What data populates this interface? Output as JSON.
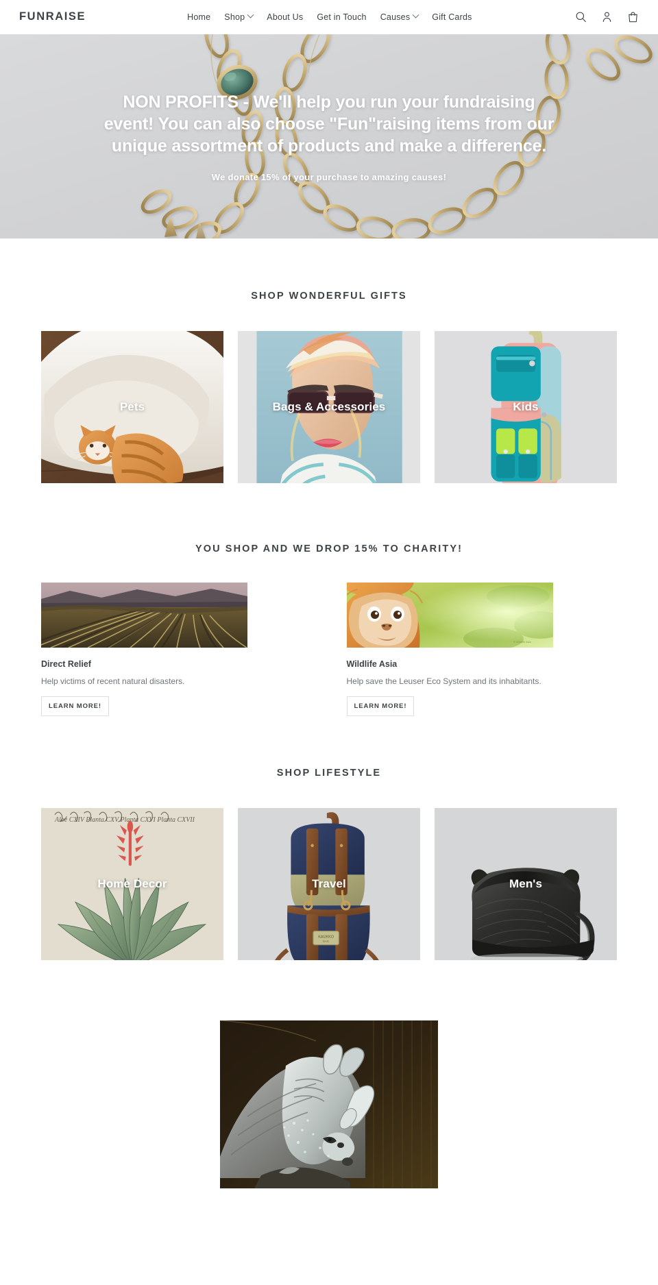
{
  "header": {
    "brand": "FUNRAISE",
    "nav": [
      {
        "label": "Home",
        "has_dropdown": false
      },
      {
        "label": "Shop",
        "has_dropdown": true
      },
      {
        "label": "About Us",
        "has_dropdown": false
      },
      {
        "label": "Get in Touch",
        "has_dropdown": false
      },
      {
        "label": "Causes",
        "has_dropdown": true
      },
      {
        "label": "Gift Cards",
        "has_dropdown": false
      }
    ],
    "icons": [
      {
        "name": "search-icon",
        "label": "Search"
      },
      {
        "name": "account-icon",
        "label": "Log in"
      },
      {
        "name": "cart-icon",
        "label": "Cart"
      }
    ]
  },
  "hero": {
    "title": "NON PROFITS - We'll help you run your fundraising event! You can also choose \"Fun\"raising items from our unique assortment of products and make a difference.",
    "subtitle": "We donate 15% of your purchase to amazing causes!"
  },
  "gifts_section": {
    "title": "SHOP WONDERFUL GIFTS",
    "collections": [
      {
        "label": "Pets",
        "art": "cat-in-blanket"
      },
      {
        "label": "Bags & Accessories",
        "art": "woman-with-sunglasses"
      },
      {
        "label": "Kids",
        "art": "colorful-backpack"
      }
    ]
  },
  "charity_section": {
    "title": "YOU SHOP AND WE DROP 15% TO CHARITY!",
    "items": [
      {
        "name": "Direct Relief",
        "description": "Help victims of recent natural disasters.",
        "button": "LEARN MORE!",
        "art": "vineyard-field"
      },
      {
        "name": "Wildlife Asia",
        "description": "Help save the Leuser Eco System and its inhabitants.",
        "button": "LEARN MORE!",
        "art": "orangutan"
      }
    ]
  },
  "lifestyle_section": {
    "title": "SHOP LIFESTYLE",
    "collections": [
      {
        "label": "Home Decor",
        "art": "botanical-aloe-print"
      },
      {
        "label": "Travel",
        "art": "navy-backpack"
      },
      {
        "label": "Men's",
        "art": "black-leather-bag"
      }
    ]
  },
  "feature": {
    "art": "rhino-painting"
  },
  "colors": {
    "text": "#3d4246",
    "muted": "#6f7478",
    "hero_bg": "#d3d4d6",
    "card_bg": "#d6d7d9",
    "border": "#dcdedf"
  }
}
